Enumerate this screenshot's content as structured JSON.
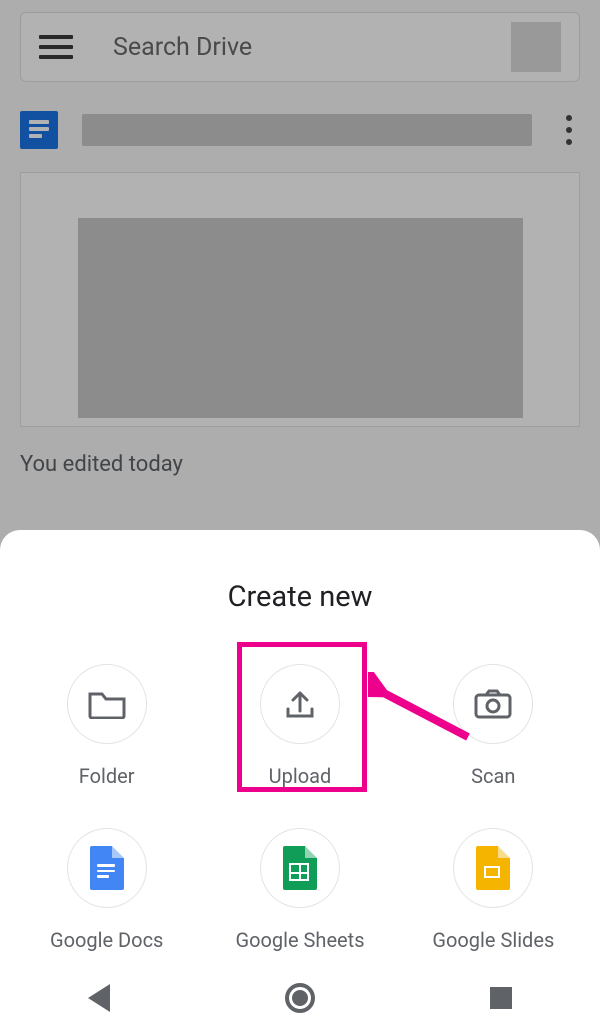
{
  "search": {
    "placeholder": "Search Drive"
  },
  "file": {
    "edited_label": "You edited today"
  },
  "sheet": {
    "title": "Create new",
    "items": [
      {
        "label": "Folder",
        "icon": "folder-icon"
      },
      {
        "label": "Upload",
        "icon": "upload-icon"
      },
      {
        "label": "Scan",
        "icon": "camera-icon"
      },
      {
        "label": "Google Docs",
        "icon": "google-docs-icon"
      },
      {
        "label": "Google Sheets",
        "icon": "google-sheets-icon"
      },
      {
        "label": "Google Slides",
        "icon": "google-slides-icon"
      }
    ]
  },
  "annotation": {
    "highlighted_item_index": 1,
    "color": "#ec008c"
  }
}
